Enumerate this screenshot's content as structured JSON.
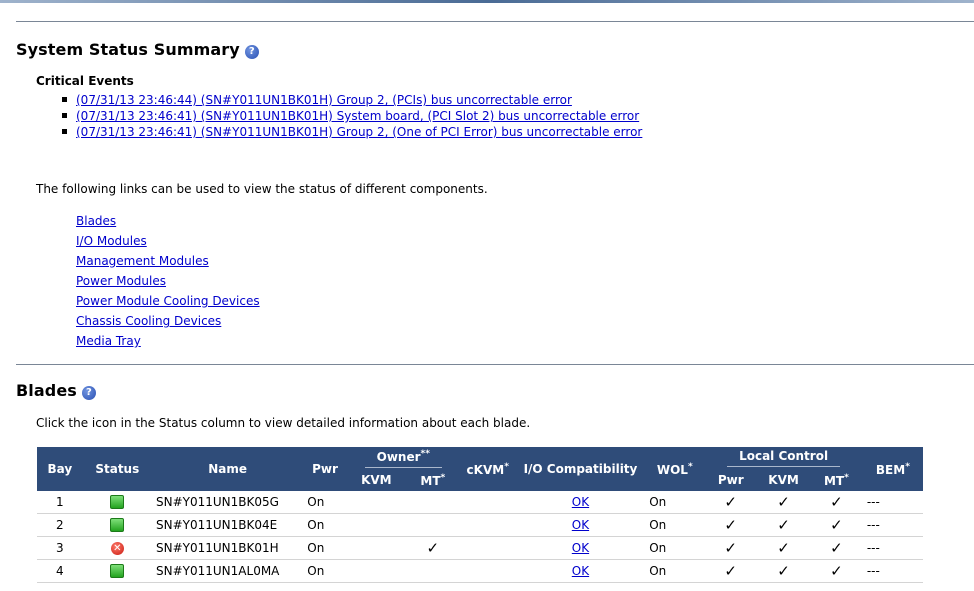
{
  "summary": {
    "title": "System Status Summary",
    "help": "?",
    "critical_label": "Critical Events",
    "events": [
      "(07/31/13 23:46:44) (SN#Y011UN1BK01H) Group 2, (PCIs) bus uncorrectable error",
      "(07/31/13 23:46:41) (SN#Y011UN1BK01H) System board, (PCI Slot 2) bus uncorrectable error",
      "(07/31/13 23:46:41) (SN#Y011UN1BK01H) Group 2, (One of PCI Error) bus uncorrectable error"
    ],
    "intro": "The following links can be used to view the status of different components.",
    "links": [
      "Blades",
      "I/O Modules",
      "Management Modules",
      "Power Modules",
      "Power Module Cooling Devices",
      "Chassis Cooling Devices",
      "Media Tray"
    ]
  },
  "blades": {
    "title": "Blades",
    "help": "?",
    "instruction": "Click the icon in the Status column to view detailed information about each blade.",
    "headers": {
      "bay": "Bay",
      "status": "Status",
      "name": "Name",
      "pwr": "Pwr",
      "owner": "Owner",
      "owner_sup": "**",
      "kvm": "KVM",
      "mt": "MT",
      "mt_sup": "*",
      "ckvm": "cKVM",
      "ckvm_sup": "*",
      "io": "I/O Compatibility",
      "wol": "WOL",
      "wol_sup": "*",
      "local": "Local Control",
      "lc_pwr": "Pwr",
      "lc_kvm": "KVM",
      "lc_mt": "MT",
      "lc_mt_sup": "*",
      "bem": "BEM",
      "bem_sup": "*"
    },
    "rows": [
      {
        "bay": "1",
        "status": "ok",
        "status_glyph": "",
        "name": "SN#Y011UN1BK05G",
        "pwr": "On",
        "owner_kvm": "",
        "owner_mt": "",
        "ckvm": "",
        "io": "OK",
        "wol": "On",
        "lc_pwr": "✓",
        "lc_kvm": "✓",
        "lc_mt": "✓",
        "bem": "---"
      },
      {
        "bay": "2",
        "status": "ok",
        "status_glyph": "",
        "name": "SN#Y011UN1BK04E",
        "pwr": "On",
        "owner_kvm": "",
        "owner_mt": "",
        "ckvm": "",
        "io": "OK",
        "wol": "On",
        "lc_pwr": "✓",
        "lc_kvm": "✓",
        "lc_mt": "✓",
        "bem": "---"
      },
      {
        "bay": "3",
        "status": "error",
        "status_glyph": "✕",
        "name": "SN#Y011UN1BK01H",
        "pwr": "On",
        "owner_kvm": "",
        "owner_mt": "✓",
        "ckvm": "",
        "io": "OK",
        "wol": "On",
        "lc_pwr": "✓",
        "lc_kvm": "✓",
        "lc_mt": "✓",
        "bem": "---"
      },
      {
        "bay": "4",
        "status": "ok",
        "status_glyph": "",
        "name": "SN#Y011UN1AL0MA",
        "pwr": "On",
        "owner_kvm": "",
        "owner_mt": "",
        "ckvm": "",
        "io": "OK",
        "wol": "On",
        "lc_pwr": "✓",
        "lc_kvm": "✓",
        "lc_mt": "✓",
        "bem": "---"
      }
    ]
  },
  "colors": {
    "header_bg": "#2f4c79",
    "link": "#0000cc",
    "ok": "#23a31f",
    "error": "#c81a10"
  }
}
